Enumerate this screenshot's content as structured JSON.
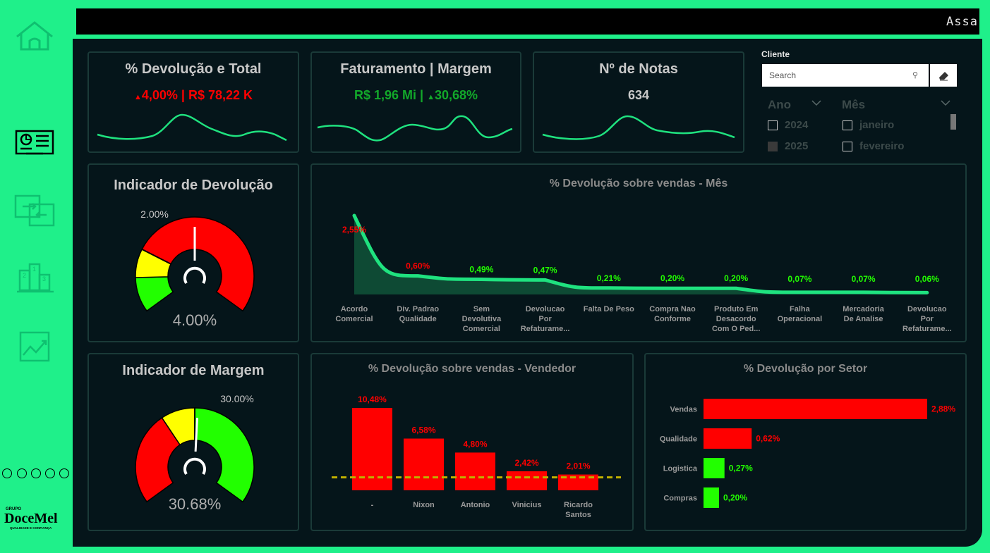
{
  "topbar": {
    "ticker": "Assa"
  },
  "sidebar": {
    "items": [
      "home-icon",
      "dashboard-icon",
      "transfer-icon",
      "ranking-icon",
      "trend-icon"
    ],
    "logo": {
      "small": "GRUPO",
      "name": "DoceMel",
      "tagline": "QUALIDADE E CONFIANÇA"
    }
  },
  "kpis": [
    {
      "title": "% Devolução e Total",
      "arrow": "▲",
      "value": "4,00% |  R$ 78,22 K",
      "color": "#ff0000"
    },
    {
      "title": "Faturamento | Margem",
      "value_a": "R$ 1,96 Mi | ",
      "arrow": "▲",
      "value_b": "30,68%",
      "color": "#12a82a"
    },
    {
      "title": "Nº de Notas",
      "value": "634",
      "color": "#c8c8c8"
    }
  ],
  "filters": {
    "cliente_label": "Cliente",
    "search_placeholder": "Search",
    "ano_label": "Ano",
    "mes_label": "Mês",
    "anos": [
      "2024",
      "2025"
    ],
    "meses": [
      "janeiro",
      "fevereiro"
    ]
  },
  "gauges": [
    {
      "title": "Indicador de Devolução",
      "target_label": "2.00%",
      "value_label": "4.00%",
      "value": 4.0,
      "target": 2.0,
      "max": 8.0
    },
    {
      "title": "Indicador de Margem",
      "target_label": "30.00%",
      "value_label": "30.68%",
      "value": 30.68,
      "target": 30.0,
      "max": 60.0
    }
  ],
  "chart_data": [
    {
      "type": "area",
      "title": "% Devolução sobre vendas - Mês",
      "categories": [
        "Acordo Comercial",
        "Div. Padrao Qualidade",
        "Sem Devolutiva Comercial",
        "Devolucao Por Refaturame...",
        "Falta De Peso",
        "Compra Nao Conforme",
        "Produto Em Desacordo Com O Ped...",
        "Falha Operacional",
        "Mercadoria De Analise",
        "Devolucao Por Refaturame..."
      ],
      "labels": [
        "2,55%",
        "0,60%",
        "0,49%",
        "0,47%",
        "0,21%",
        "0,20%",
        "0,20%",
        "0,07%",
        "0,07%",
        "0,06%"
      ],
      "values": [
        2.55,
        0.6,
        0.49,
        0.47,
        0.21,
        0.2,
        0.2,
        0.07,
        0.07,
        0.06
      ],
      "color": "#1fe27f"
    },
    {
      "type": "bar",
      "title": "% Devolução sobre vendas - Vendedor",
      "categories": [
        "-",
        "Nixon",
        "Antonio",
        "Vinicius",
        "Ricardo Santos"
      ],
      "labels": [
        "10,48%",
        "6,58%",
        "4,80%",
        "2,42%",
        "2,01%"
      ],
      "values": [
        10.48,
        6.58,
        4.8,
        2.42,
        2.01
      ],
      "reference": 2.0,
      "color": "#ff0000"
    },
    {
      "type": "bar",
      "orientation": "horizontal",
      "title": "% Devolução por Setor",
      "categories": [
        "Vendas",
        "Qualidade",
        "Logistica",
        "Compras"
      ],
      "labels": [
        "2,88%",
        "0,62%",
        "0,27%",
        "0,20%"
      ],
      "values": [
        2.88,
        0.62,
        0.27,
        0.2
      ],
      "colors": [
        "#ff0000",
        "#ff0000",
        "#22ff00",
        "#22ff00"
      ]
    }
  ]
}
